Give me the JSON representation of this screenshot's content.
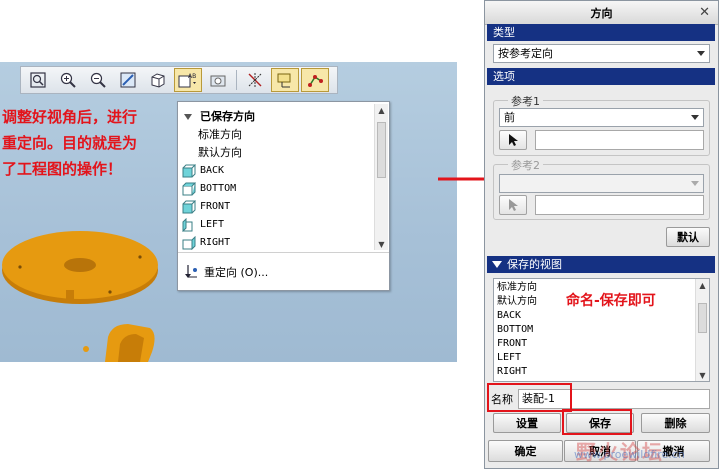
{
  "annotations": {
    "left_line1": "调整好视角后，进行",
    "left_line2": "重定向。目的就是为",
    "left_line3": "了工程图的操作！",
    "right": "命名-保存即可"
  },
  "view_menu": {
    "header": "已保存方向",
    "items": [
      "标准方向",
      "默认方向"
    ],
    "named_views": [
      "BACK",
      "BOTTOM",
      "FRONT",
      "LEFT",
      "RIGHT"
    ],
    "footer": "重定向 (O)..."
  },
  "toolbar": {
    "icons": [
      "zoom-window-icon",
      "zoom-in-icon",
      "zoom-out-icon",
      "refit-icon",
      "display-style-icon",
      "saved-views-icon",
      "camera-icon",
      "datum-display-icon",
      "csys-display-icon",
      "spin-center-icon"
    ]
  },
  "dialog": {
    "title": "方向",
    "close_glyph": "✕",
    "type_section": "类型",
    "type_value": "按参考定向",
    "options_section": "选项",
    "ref1_label": "参考1",
    "ref1_value": "前",
    "ref2_label": "参考2",
    "default_button": "默认",
    "saved_section": "保存的视图",
    "saved_views": [
      "标准方向",
      "默认方向",
      "BACK",
      "BOTTOM",
      "FRONT",
      "LEFT",
      "RIGHT"
    ],
    "name_label": "名称",
    "name_value": "装配-1",
    "set_button": "设置",
    "save_button": "保存",
    "delete_button": "删除",
    "ok_button": "确定",
    "cancel_button": "取消",
    "undo_button": "撤消"
  },
  "watermark": {
    "text": "野火论坛",
    "url": "www.proewildfire.cn"
  },
  "colors": {
    "annotation_red": "#e3141b",
    "section_header": "#153183",
    "model_orange": "#e69a10"
  }
}
